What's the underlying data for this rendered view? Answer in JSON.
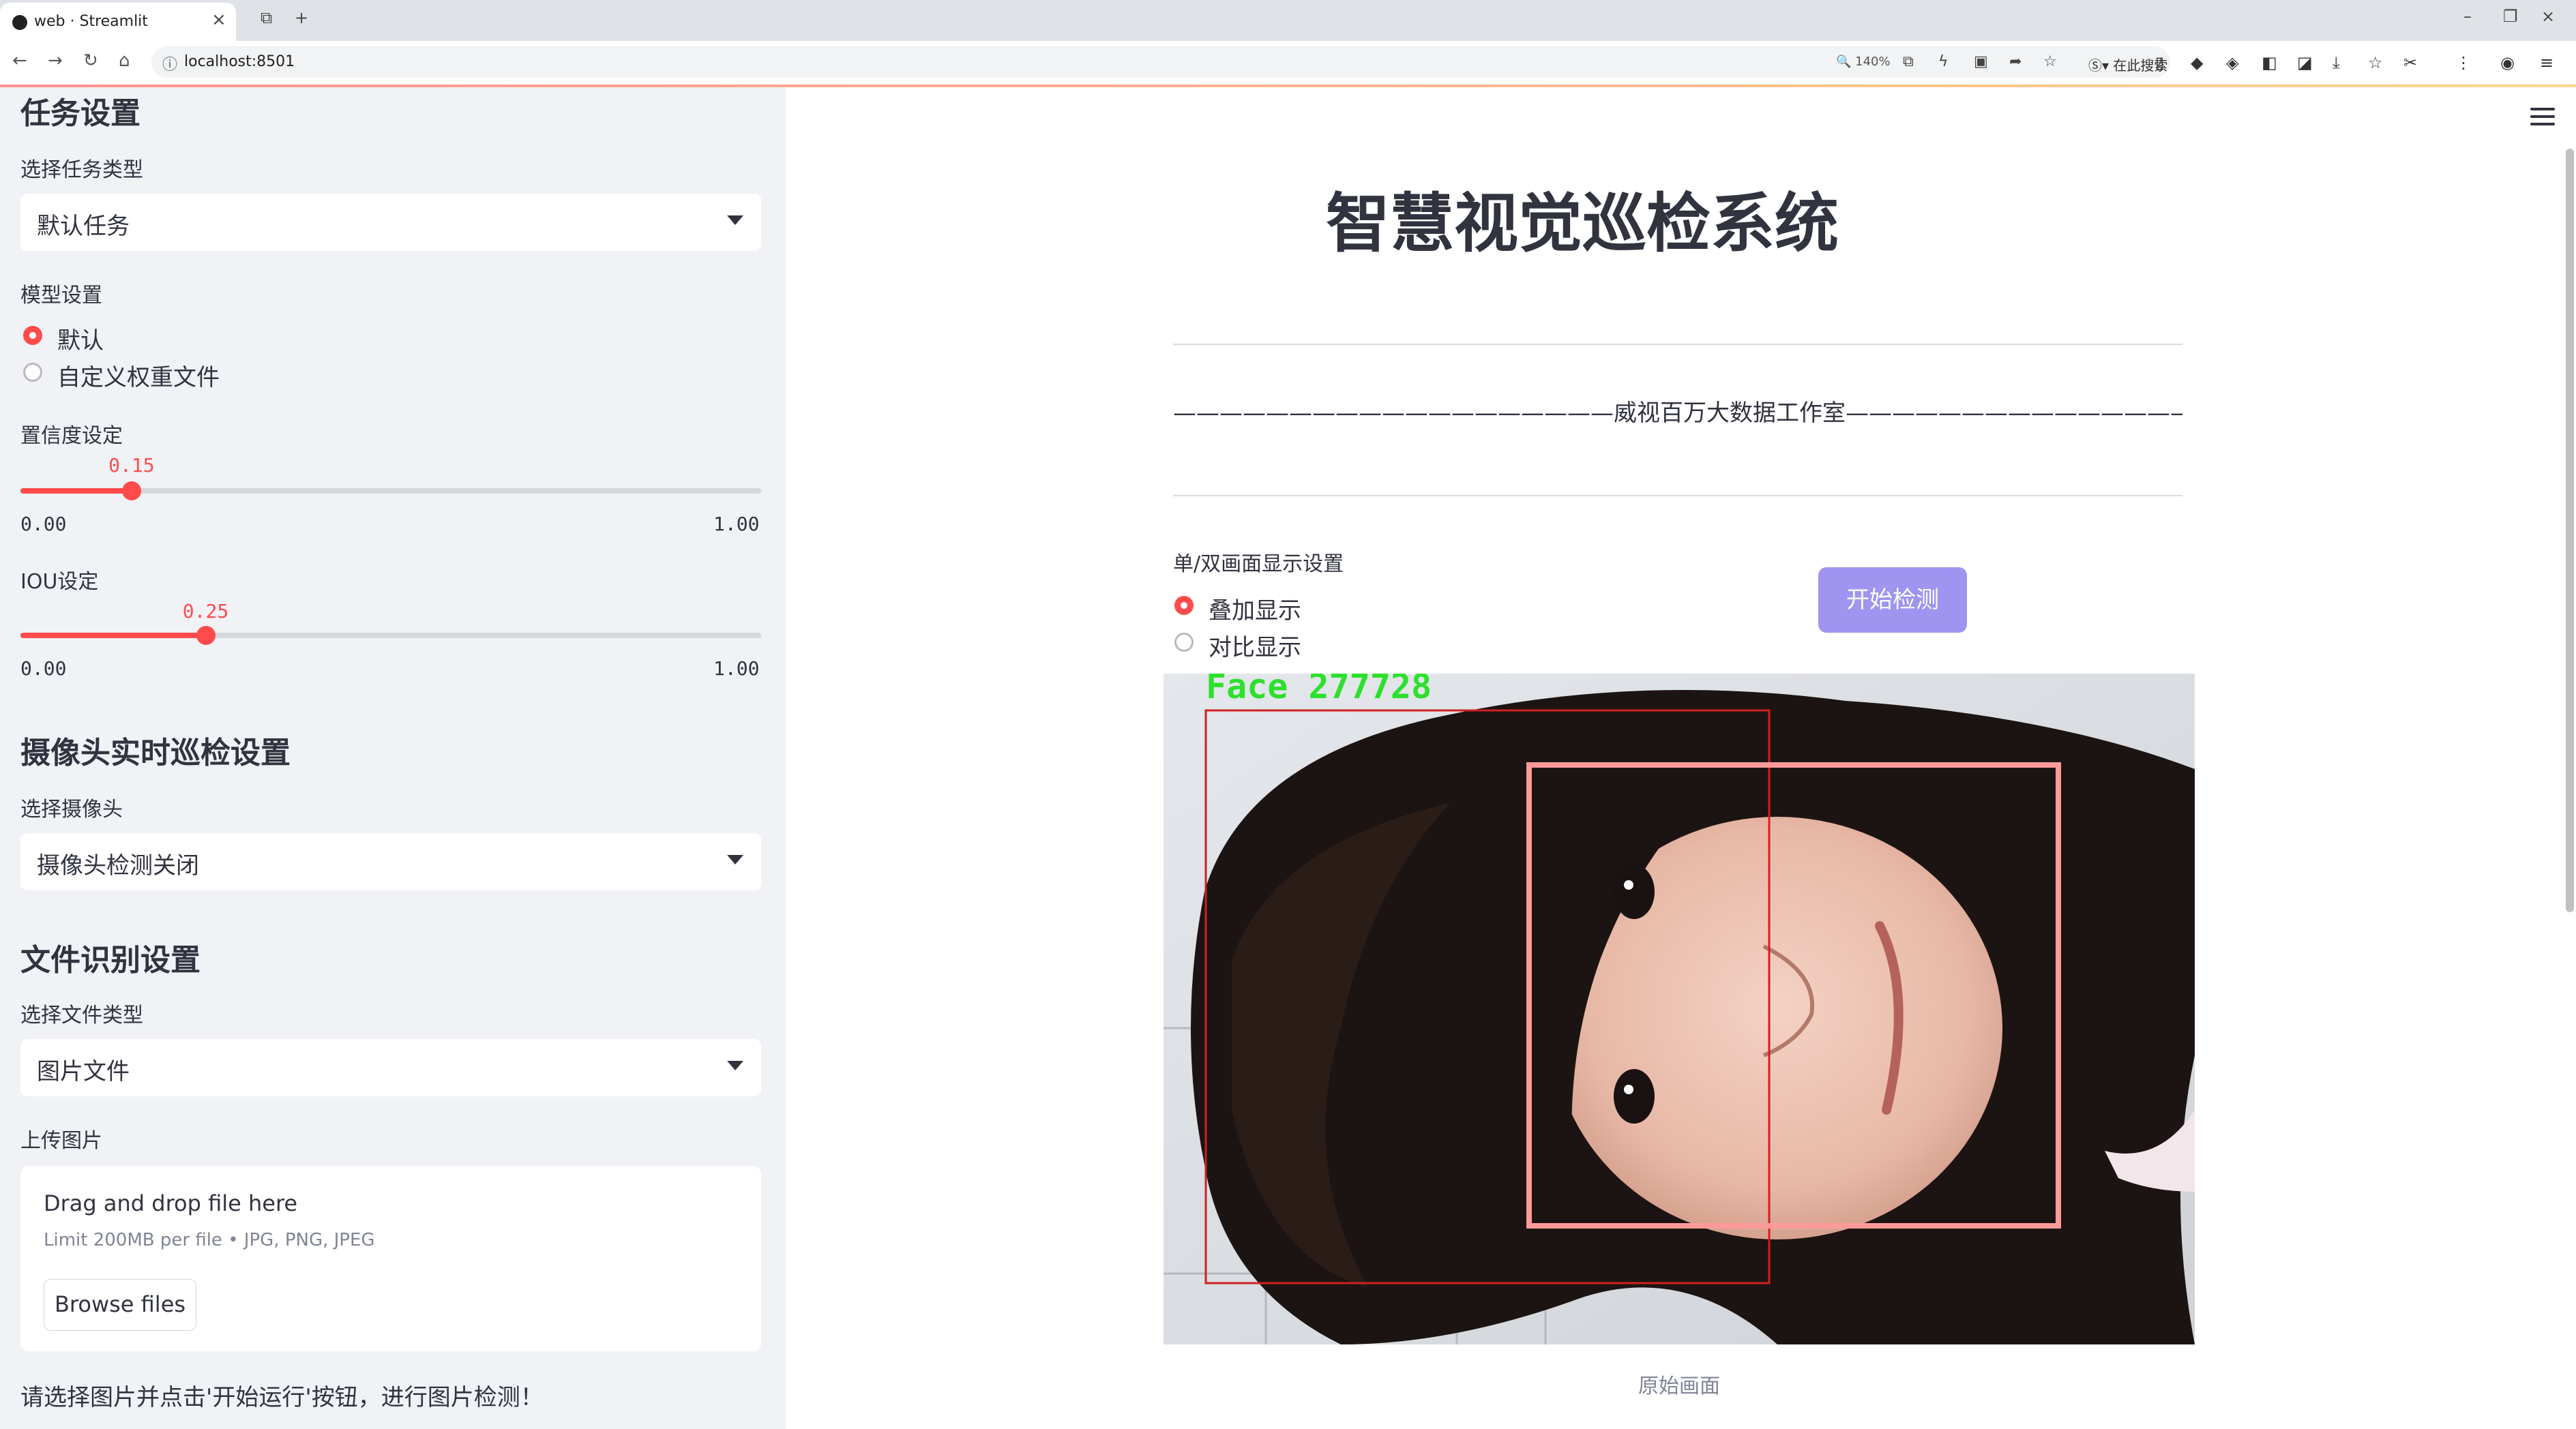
{
  "browser": {
    "tab_title": "web · Streamlit",
    "url": "localhost:8501",
    "zoom": "140%",
    "search_engine_text": "在此搜索"
  },
  "sidebar": {
    "task_heading": "任务设置",
    "task_type_label": "选择任务类型",
    "task_type_value": "默认任务",
    "model_label": "模型设置",
    "model_options": [
      "默认",
      "自定义权重文件"
    ],
    "model_selected": 0,
    "conf_label": "置信度设定",
    "conf_value": "0.15",
    "conf_min": "0.00",
    "conf_max": "1.00",
    "conf_fraction": 0.15,
    "iou_label": "IOU设定",
    "iou_value": "0.25",
    "iou_min": "0.00",
    "iou_max": "1.00",
    "iou_fraction": 0.25,
    "camera_heading": "摄像头实时巡检设置",
    "camera_label": "选择摄像头",
    "camera_value": "摄像头检测关闭",
    "file_heading": "文件识别设置",
    "file_type_label": "选择文件类型",
    "file_type_value": "图片文件",
    "upload_label": "上传图片",
    "upload_title": "Drag and drop file here",
    "upload_limit": "Limit 200MB per file • JPG, PNG, JPEG",
    "browse_label": "Browse files",
    "note": "请选择图片并点击'开始运行'按钮，进行图片检测！"
  },
  "main": {
    "title": "智慧视觉巡检系统",
    "banner": "———————————————————威视百万大数据工作室————————————————————",
    "display_label": "单/双画面显示设置",
    "display_options": [
      "叠加显示",
      "对比显示"
    ],
    "display_selected": 0,
    "start_button": "开始检测",
    "detection_label": "Face 277728",
    "caption": "原始画面"
  },
  "colors": {
    "accent": "#ff4b4b",
    "button": "#9f95f0",
    "sidebar_bg": "#f0f2f6",
    "detection_text": "#2de02d",
    "detection_box": "#ff9a9a"
  }
}
